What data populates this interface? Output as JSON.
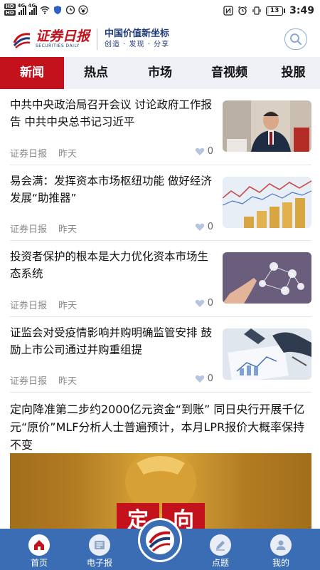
{
  "status_bar": {
    "hd1": "HD",
    "hd2": "HD",
    "net1": "4G",
    "net2": "4G",
    "battery": "13",
    "time": "3:49"
  },
  "header": {
    "logo_cn": "证券日报",
    "logo_en": "SECURITIES DAILY",
    "slogan_main": "中国价值新坐标",
    "slogan_sub": "创造 · 发现 · 分享"
  },
  "tabs": [
    {
      "label": "新闻",
      "active": true
    },
    {
      "label": "热点",
      "active": false
    },
    {
      "label": "市场",
      "active": false
    },
    {
      "label": "音视频",
      "active": false
    },
    {
      "label": "投服",
      "active": false
    }
  ],
  "news": [
    {
      "title": "中共中央政治局召开会议 讨论政府工作报告 中共中央总书记习近平",
      "source": "证券日报",
      "time": "昨天",
      "likes": "0"
    },
    {
      "title": "易会满：发挥资本市场枢纽功能 做好经济发展“助推器”",
      "source": "证券日报",
      "time": "昨天",
      "likes": "0"
    },
    {
      "title": "投资者保护的根本是大力优化资本市场生态系统",
      "source": "证券日报",
      "time": "昨天",
      "likes": "0"
    },
    {
      "title": "证监会对受疫情影响并购明确监管安排 鼓励上市公司通过并购重组提",
      "source": "证券日报",
      "time": "昨天",
      "likes": "0"
    }
  ],
  "featured": {
    "title": "定向降准第二步约2000亿元资金“到账” 同日央行开展千亿元“原价”MLF分析人士普遍预计，本月LPR报价大概率保持不变",
    "image_text": "定 向"
  },
  "bottom_nav": [
    {
      "label": "首页",
      "icon": "home-icon",
      "active": true
    },
    {
      "label": "电子报",
      "icon": "newspaper-icon",
      "active": false
    },
    {
      "label": "点题",
      "icon": "edit-icon",
      "active": false
    },
    {
      "label": "我的",
      "icon": "user-icon",
      "active": false
    }
  ],
  "colors": {
    "brand_red": "#c3121c",
    "brand_blue": "#3b6db5",
    "tab_bg": "#eef0f5"
  }
}
